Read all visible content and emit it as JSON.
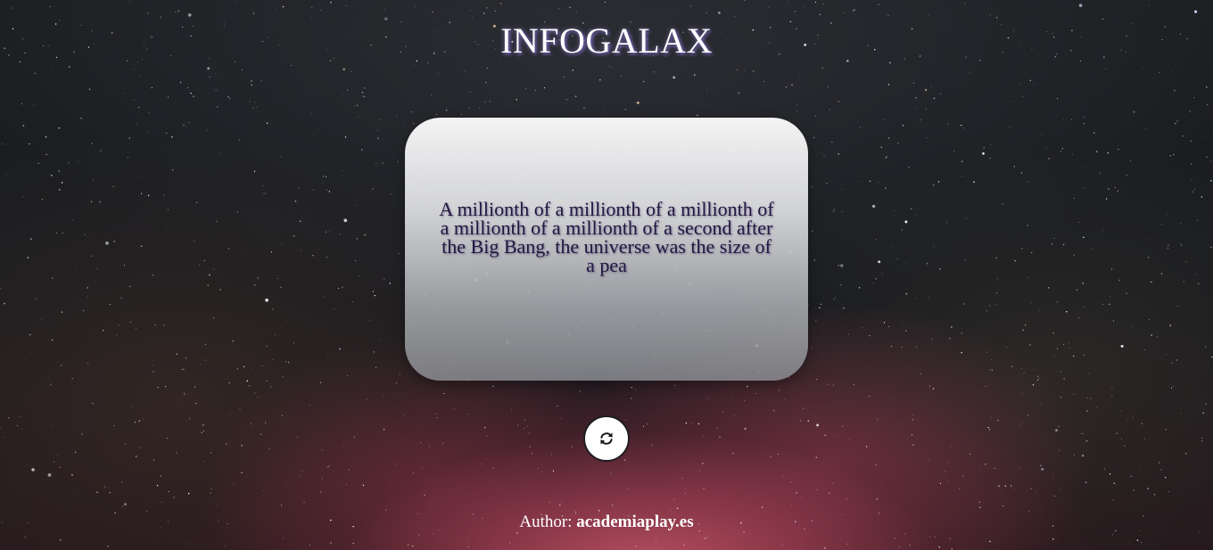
{
  "header": {
    "title": "INFOGALAX"
  },
  "fact_card": {
    "text": "A millionth of a millionth of a millionth of a millionth of a millionth of a second after the Big Bang, the universe was the size of a pea"
  },
  "refresh_button": {
    "icon": "refresh-icon"
  },
  "footer": {
    "author_label": "Author:",
    "author_link": "academiaplay.es"
  },
  "colors": {
    "title_text": "#ffffff",
    "title_glow": "#6b5aa8",
    "fact_text": "#23173f",
    "card_top": "#fafafa",
    "card_bottom": "#8c8f94",
    "button_bg": "#ffffff",
    "button_border": "#1c1c22",
    "nebula": "#d65a6e"
  }
}
